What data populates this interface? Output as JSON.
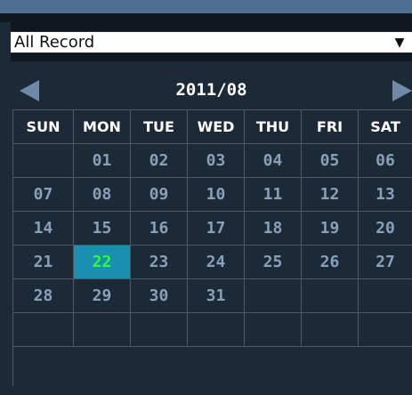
{
  "filter": {
    "value": "All Record",
    "arrow_icon": "dropdown-arrow-icon"
  },
  "calendar": {
    "title": "2011/08",
    "prev_icon": "triangle-left-icon",
    "next_icon": "triangle-right-icon",
    "weekdays": [
      "SUN",
      "MON",
      "TUE",
      "WED",
      "THU",
      "FRI",
      "SAT"
    ],
    "weeks": [
      [
        "",
        "01",
        "02",
        "03",
        "04",
        "05",
        "06"
      ],
      [
        "07",
        "08",
        "09",
        "10",
        "11",
        "12",
        "13"
      ],
      [
        "14",
        "15",
        "16",
        "17",
        "18",
        "19",
        "20"
      ],
      [
        "21",
        "22",
        "23",
        "24",
        "25",
        "26",
        "27"
      ],
      [
        "28",
        "29",
        "30",
        "31",
        "",
        "",
        ""
      ],
      [
        "",
        "",
        "",
        "",
        "",
        "",
        ""
      ]
    ],
    "selected_day": "22",
    "colors": {
      "today_text": "#2aff3a",
      "today_bg": "#1a8fb0",
      "day_text": "#8aa0b6"
    }
  }
}
